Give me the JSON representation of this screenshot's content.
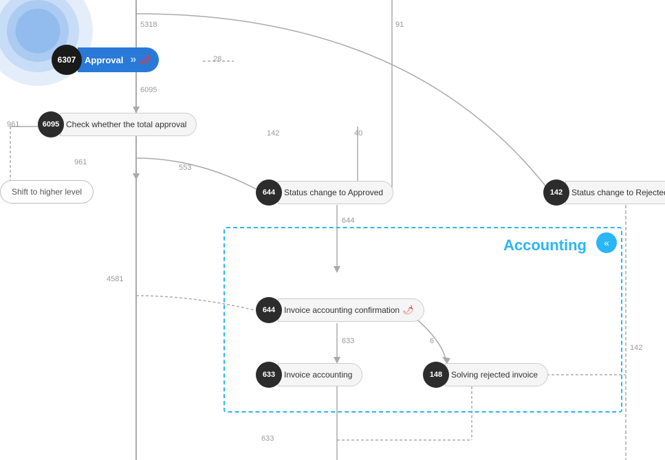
{
  "nodes": {
    "approval": {
      "id": "6307",
      "label": "Approval",
      "type": "highlighted"
    },
    "check_approval": {
      "id": "6095",
      "label": "Check whether the total approval"
    },
    "shift_higher": {
      "label": "Shift to higher level"
    },
    "status_approved": {
      "id": "644",
      "label": "Status change to Approved"
    },
    "status_rejected": {
      "id": "142",
      "label": "Status change to Rejected"
    },
    "invoice_confirm": {
      "id": "644",
      "label": "Invoice accounting confirmation"
    },
    "invoice_accounting": {
      "id": "633",
      "label": "Invoice accounting"
    },
    "solving_rejected": {
      "id": "148",
      "label": "Solving rejected invoice"
    }
  },
  "edge_labels": {
    "e1": "5318",
    "e2": "28",
    "e3": "6095",
    "e4": "961",
    "e5": "553",
    "e6": "142",
    "e7": "40",
    "e8": "91",
    "e9": "644",
    "e10": "633",
    "e11": "6",
    "e12": "4581",
    "e13": "633",
    "e14": "142"
  },
  "accounting_box": {
    "title": "Accounting",
    "collapse_icon": "«"
  },
  "colors": {
    "blue_node": "#2979d8",
    "dark_badge": "#2c2c2c",
    "accounting_blue": "#29b6f6",
    "line_color": "#aaaaaa",
    "edge_label_color": "#999999"
  }
}
